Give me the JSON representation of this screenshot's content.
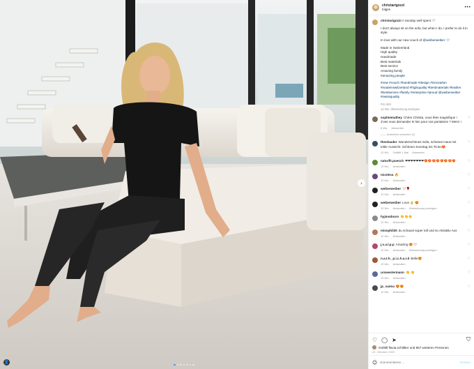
{
  "header": {
    "username": "christarigozzi",
    "subtitle": "folgen"
  },
  "caption": {
    "username": "christarigozzi",
    "line1": "A Sunday well spent 🤍",
    "line2": "I don't always sit on the sofa, but when I do, I prefer to do it in style.",
    "line3_pre": "In love with our new couch of ",
    "line3_tag": "@weiberweiber",
    "line3_post": " 🤍",
    "bullets": [
      "Made in Switzerland",
      "High quality",
      "Handmade",
      "Best materials",
      "Best service",
      "Amazing family"
    ],
    "bullet_tag": "#amazing people",
    "hashtags": "#new #couch #handmade #design #innovation #madeinswitzerland #highquality #bestmaterials #leather #bestservice #family #enterprise #proud @weiberweiber #swissquality",
    "for_you": "Für dich",
    "meta": "12 Wo.   Übersetzung anzeigen"
  },
  "comments": [
    {
      "user": "sophiemathey",
      "text": "Chère Christa, vous êtes magnifique ! J'ose vous demander le lien pour vos pantalons ? Merci !",
      "meta": [
        "6 Wo.",
        "Antworten"
      ],
      "answers": "—— Antworten ansehen (1)",
      "color": "#7a6a5a"
    },
    {
      "user": "theoloader",
      "text": "Wunderschönes Sofa, schönes Haus mit toller Aussicht. Schönen Sonntag ins Ticino😍",
      "meta": [
        "12 Wo.",
        "Gefällt 1 Mal",
        "Antworten"
      ],
      "color": "#3a4c63"
    },
    {
      "user": "naturfit.puesch",
      "text": "❤❤❤❤❤❤❤😍😍😍😍😍😍😍😍",
      "meta": [
        "12 Wo.",
        "Antworten"
      ],
      "color": "#5e8a3b"
    },
    {
      "user": "nicolesa",
      "text": "🔥",
      "meta": [
        "12 Wo.",
        "Antworten"
      ],
      "color": "#6a4a7a"
    },
    {
      "user": "weiberweiber",
      "text": "🤍🌹",
      "meta": [
        "12 Wo.",
        "Antworten"
      ],
      "color": "#222222"
    },
    {
      "user": "weiberweiber",
      "text": "Love ✌ 😍",
      "meta": [
        "12 Wo.",
        "Antworten",
        "Übersetzung anzeigen"
      ],
      "color": "#222222"
    },
    {
      "user": "hyjmodoors",
      "text": "👏👏👏",
      "meta": [
        "12 Wo.",
        "Antworten"
      ],
      "color": "#8a8a8a"
    },
    {
      "user": "missphil30",
      "text": "du schaust super toll und so Attraktiv Aus",
      "meta": [
        "12 Wo.",
        "Antworten"
      ],
      "color": "#b07a5a"
    },
    {
      "user": "j.s.a.l.p.p",
      "text": "Amazing 😍🤍",
      "meta": [
        "12 Wo.",
        "Antworten",
        "Übersetzung anzeigen"
      ],
      "color": "#b04a6a"
    },
    {
      "user": "n.a.t.h._p.i.c.h.a.r.d",
      "text": "Belle😍",
      "meta": [
        "12 Wo.",
        "Antworten"
      ],
      "color": "#9a5a3a"
    },
    {
      "user": "urswestermann",
      "text": "👏 👏",
      "meta": [
        "10 Wo.",
        "Antworten"
      ],
      "color": "#5a6a9a"
    },
    {
      "user": "jp_sanna",
      "text": "😍😍",
      "meta": [
        "12 Wo.",
        "Antworten"
      ],
      "color": "#4a4a4a"
    }
  ],
  "actions": {
    "likes_text": "Gefällt flavia.schlittler und 857 weiteren Personen",
    "date": "22. Oktober 2022"
  },
  "composer": {
    "placeholder": "Kommentieren ...",
    "post_label": "Posten"
  },
  "icons": {
    "heart": "heart-icon",
    "comment": "comment-icon",
    "share": "share-icon",
    "save": "save-icon",
    "emoji": "emoji-icon",
    "more": "more-icon",
    "next": "chevron-right-icon"
  },
  "colors": {
    "link": "#00376b",
    "muted": "#8e8e8e",
    "active_dot": "#3897f0"
  }
}
